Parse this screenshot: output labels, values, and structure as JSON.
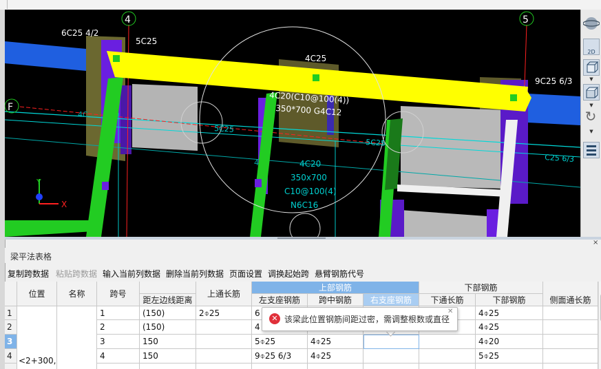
{
  "cad": {
    "axis_labels": [
      "4",
      "5",
      "F"
    ],
    "beam_labels": [
      "6C25 4/2",
      "5C25",
      "4C25",
      "9C25 6/3",
      "4C20(C10@100(4))",
      "350*700 G4C12",
      "5C25",
      "5C25",
      "C25 6/3"
    ],
    "column_labels": [
      "4C20",
      "350x700",
      "C10@100(4)",
      "N6C16"
    ],
    "cyan_marks": [
      "4C",
      "4"
    ],
    "axis_x": "X",
    "axis_y": "Y",
    "colors": {
      "beam_highlight": "#ffff00",
      "column": "#22cc22",
      "cyan_lines": "#00d8d8",
      "axis_red": "#ff2020"
    }
  },
  "right_toolbar": {
    "view_2d": "2D",
    "icons": [
      "sphere-icon",
      "view-2d-icon",
      "cube-front-icon",
      "cube-iso-icon",
      "rotate-icon",
      "grid-layers-icon"
    ]
  },
  "panel": {
    "title": "梁平法表格",
    "toolbar": {
      "copy": "复制跨数据",
      "paste": "粘贴跨数据",
      "input_col": "输入当前列数据",
      "delete_col": "删除当前列数据",
      "page_setup": "页面设置",
      "swap_span": "调换起始跨",
      "cantilever": "悬臂钢筋代号"
    },
    "headers": {
      "position": "位置",
      "name": "名称",
      "span": "跨号",
      "dist": "距左边线距离",
      "top_through": "上通长筋",
      "top_group": "上部钢筋",
      "left_support": "左支座钢筋",
      "mid_span": "跨中钢筋",
      "right_support": "右支座钢筋",
      "bottom_group": "下部钢筋",
      "bottom_through": "下通长筋",
      "bottom_bar": "下部钢筋",
      "side_through": "侧面通长筋"
    },
    "rows": [
      {
        "num": "1",
        "span": "1",
        "dist": "(150)",
        "top_through": "2⌽25",
        "left": "6",
        "mid": "",
        "right": "",
        "bt": "",
        "bottom": "4⌽25"
      },
      {
        "num": "2",
        "span": "2",
        "dist": "(150)",
        "top_through": "",
        "left": "4",
        "mid": "",
        "right": "",
        "bt": "",
        "bottom": "4⌽25"
      },
      {
        "num": "3",
        "span": "3",
        "dist": "150",
        "top_through": "",
        "left": "5⌽25",
        "mid": "4⌽25",
        "right": "",
        "bt": "",
        "bottom": "4⌽20"
      },
      {
        "num": "4",
        "span": "4",
        "dist": "150",
        "top_through": "",
        "left": "9⌽25 6/3",
        "mid": "4⌽25",
        "right": "",
        "bt": "",
        "bottom": "5⌽25"
      }
    ],
    "position_value": "<2+300,",
    "tooltip": "该梁此位置钢筋间距过密，需调整根数或直径"
  }
}
